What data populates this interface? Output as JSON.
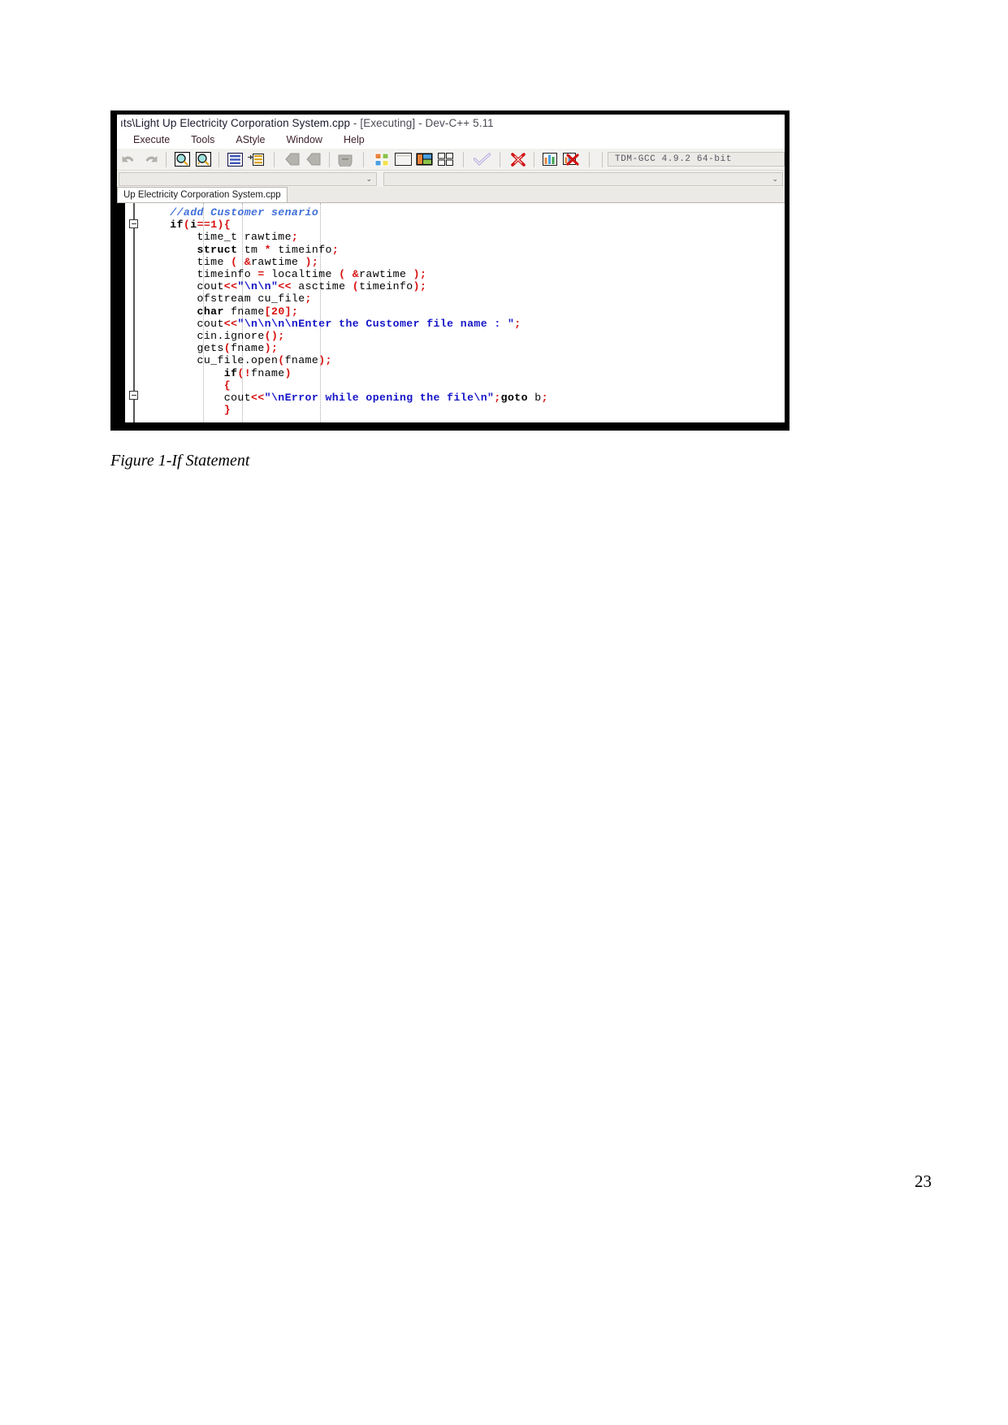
{
  "document": {
    "page_number": "23",
    "figure_caption": "Figure 1-If Statement"
  },
  "window": {
    "title": "ıts\\Light Up Electricity Corporation System.cpp - [Executing] - Dev-C++ 5.11",
    "title_main": "ıts\\Light Up Electricity Corporation System.cpp",
    "title_suffix": " - [Executing] - Dev-C++ 5.11"
  },
  "menubar": {
    "items": [
      {
        "label": "Execute"
      },
      {
        "label": "Tools"
      },
      {
        "label": "AStyle"
      },
      {
        "label": "Window"
      },
      {
        "label": "Help"
      }
    ]
  },
  "toolbar": {
    "buttons": [
      {
        "name": "undo-icon",
        "title": "Undo"
      },
      {
        "name": "redo-icon",
        "title": "Redo"
      },
      {
        "name": "find-icon",
        "title": "Find"
      },
      {
        "name": "find-next-icon",
        "title": "Find Next"
      },
      {
        "name": "goto-line-icon",
        "title": "Goto Line"
      },
      {
        "name": "goto-function-icon",
        "title": "Goto Function"
      },
      {
        "name": "back-icon",
        "title": "Back"
      },
      {
        "name": "forward-icon",
        "title": "Forward"
      },
      {
        "name": "toggle-breakpoint-icon",
        "title": "Toggle Breakpoint"
      },
      {
        "name": "new-project-icon",
        "title": "New Project"
      },
      {
        "name": "window-icon",
        "title": "Window"
      },
      {
        "name": "project-view-icon",
        "title": "Project View"
      },
      {
        "name": "tile-icon",
        "title": "Tile"
      },
      {
        "name": "compile-check-icon",
        "title": "Compile"
      },
      {
        "name": "stop-execution-icon",
        "title": "Stop Execution"
      },
      {
        "name": "profile-icon",
        "title": "Profile Analysis"
      },
      {
        "name": "delete-profile-icon",
        "title": "Delete Profile"
      }
    ],
    "compiler_select": "TDM-GCC  4.9.2  64-bit"
  },
  "combos": {
    "left_value": "",
    "right_value": "",
    "caret": "⌄"
  },
  "editor": {
    "tab_label": "Up Electricity Corporation System.cpp",
    "code_lines": [
      {
        "indent": 4,
        "tokens": [
          {
            "t": "//add Customer senario",
            "c": "c-comment"
          }
        ]
      },
      {
        "indent": 4,
        "tokens": [
          {
            "t": "if",
            "c": "c-key"
          },
          {
            "t": "(",
            "c": "c-punct"
          },
          {
            "t": "i",
            "c": "c-key"
          },
          {
            "t": "==",
            "c": "c-punct"
          },
          {
            "t": "1",
            "c": "c-num"
          },
          {
            "t": ")",
            "c": "c-punct"
          },
          {
            "t": "{",
            "c": "c-punct"
          }
        ]
      },
      {
        "indent": 8,
        "tokens": [
          {
            "t": "time_t rawtime",
            "c": "c-plain"
          },
          {
            "t": ";",
            "c": "c-punct"
          }
        ]
      },
      {
        "indent": 8,
        "tokens": [
          {
            "t": "struct",
            "c": "c-key"
          },
          {
            "t": " tm ",
            "c": "c-plain"
          },
          {
            "t": "*",
            "c": "c-punct"
          },
          {
            "t": " timeinfo",
            "c": "c-plain"
          },
          {
            "t": ";",
            "c": "c-punct"
          }
        ]
      },
      {
        "indent": 0,
        "tokens": [
          {
            "t": "",
            "c": "c-plain"
          }
        ]
      },
      {
        "indent": 8,
        "tokens": [
          {
            "t": "time ",
            "c": "c-plain"
          },
          {
            "t": "(",
            "c": "c-punct"
          },
          {
            "t": " ",
            "c": "c-plain"
          },
          {
            "t": "&",
            "c": "c-punct"
          },
          {
            "t": "rawtime ",
            "c": "c-plain"
          },
          {
            "t": ");",
            "c": "c-punct"
          }
        ]
      },
      {
        "indent": 8,
        "tokens": [
          {
            "t": "timeinfo ",
            "c": "c-plain"
          },
          {
            "t": "=",
            "c": "c-punct"
          },
          {
            "t": " localtime ",
            "c": "c-plain"
          },
          {
            "t": "(",
            "c": "c-punct"
          },
          {
            "t": " ",
            "c": "c-plain"
          },
          {
            "t": "&",
            "c": "c-punct"
          },
          {
            "t": "rawtime ",
            "c": "c-plain"
          },
          {
            "t": ");",
            "c": "c-punct"
          }
        ]
      },
      {
        "indent": 8,
        "tokens": [
          {
            "t": "cout",
            "c": "c-plain"
          },
          {
            "t": "<<",
            "c": "c-punct"
          },
          {
            "t": "\"\\n\\n\"",
            "c": "c-str"
          },
          {
            "t": "<<",
            "c": "c-punct"
          },
          {
            "t": " asctime ",
            "c": "c-plain"
          },
          {
            "t": "(",
            "c": "c-punct"
          },
          {
            "t": "timeinfo",
            "c": "c-plain"
          },
          {
            "t": ");",
            "c": "c-punct"
          }
        ]
      },
      {
        "indent": 8,
        "tokens": [
          {
            "t": "ofstream cu_file",
            "c": "c-plain"
          },
          {
            "t": ";",
            "c": "c-punct"
          }
        ]
      },
      {
        "indent": 8,
        "tokens": [
          {
            "t": "char",
            "c": "c-key"
          },
          {
            "t": " fname",
            "c": "c-plain"
          },
          {
            "t": "[",
            "c": "c-punct"
          },
          {
            "t": "20",
            "c": "c-num"
          },
          {
            "t": "];",
            "c": "c-punct"
          }
        ]
      },
      {
        "indent": 8,
        "tokens": [
          {
            "t": "cout",
            "c": "c-plain"
          },
          {
            "t": "<<",
            "c": "c-punct"
          },
          {
            "t": "\"\\n\\n\\n\\nEnter the Customer file name : \"",
            "c": "c-str"
          },
          {
            "t": ";",
            "c": "c-punct"
          }
        ]
      },
      {
        "indent": 8,
        "tokens": [
          {
            "t": "cin.ignore",
            "c": "c-plain"
          },
          {
            "t": "();",
            "c": "c-punct"
          }
        ]
      },
      {
        "indent": 8,
        "tokens": [
          {
            "t": "gets",
            "c": "c-plain"
          },
          {
            "t": "(",
            "c": "c-punct"
          },
          {
            "t": "fname",
            "c": "c-plain"
          },
          {
            "t": ");",
            "c": "c-punct"
          }
        ]
      },
      {
        "indent": 8,
        "tokens": [
          {
            "t": "cu_file.open",
            "c": "c-plain"
          },
          {
            "t": "(",
            "c": "c-punct"
          },
          {
            "t": "fname",
            "c": "c-plain"
          },
          {
            "t": ");",
            "c": "c-punct"
          }
        ]
      },
      {
        "indent": 12,
        "tokens": [
          {
            "t": "if",
            "c": "c-key"
          },
          {
            "t": "(!",
            "c": "c-punct"
          },
          {
            "t": "fname",
            "c": "c-plain"
          },
          {
            "t": ")",
            "c": "c-punct"
          }
        ]
      },
      {
        "indent": 12,
        "tokens": [
          {
            "t": "{",
            "c": "c-punct"
          }
        ]
      },
      {
        "indent": 12,
        "tokens": [
          {
            "t": "cout",
            "c": "c-plain"
          },
          {
            "t": "<<",
            "c": "c-punct"
          },
          {
            "t": "\"\\nError while opening the file\\n\"",
            "c": "c-str"
          },
          {
            "t": ";",
            "c": "c-punct"
          },
          {
            "t": "goto",
            "c": "c-key"
          },
          {
            "t": " b",
            "c": "c-plain"
          },
          {
            "t": ";",
            "c": "c-punct"
          }
        ]
      },
      {
        "indent": 12,
        "tokens": [
          {
            "t": "}",
            "c": "c-punct"
          }
        ]
      }
    ]
  }
}
